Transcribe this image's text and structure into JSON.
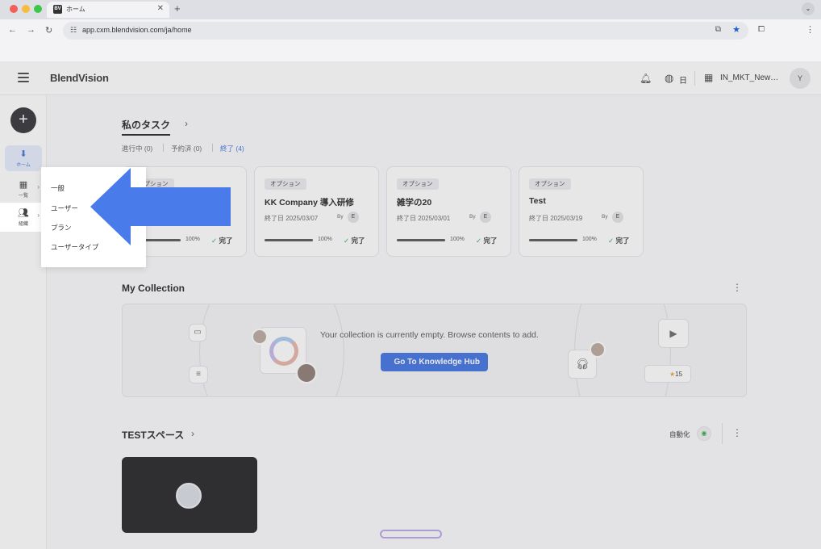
{
  "browser": {
    "tab_title": "ホーム",
    "favicon": "BV",
    "url": "app.cxm.blendvision.com/ja/home"
  },
  "header": {
    "logo": "BlendVision",
    "lang": "日",
    "org": "IN_MKT_New…",
    "avatar": "Y"
  },
  "sidebar": {
    "add": "+",
    "items": [
      {
        "label": "ホーム"
      },
      {
        "label": "一覧"
      },
      {
        "label": "組織"
      }
    ]
  },
  "submenu": {
    "items": [
      "一般",
      "ユーザー",
      "プラン",
      "ユーザータイプ"
    ]
  },
  "tasks": {
    "title": "私のタスク",
    "tabs": [
      "進行中 (0)",
      "予約済 (0)",
      "終了 (4)"
    ],
    "cards": [
      {
        "badge": "オプション",
        "title": "",
        "meta": "",
        "by": "",
        "pct": "100%",
        "done": "完了",
        "progress": 1.0
      },
      {
        "badge": "オプション",
        "title": "KK Company 導入研修",
        "meta": "終了日 2025/03/07",
        "by": "By",
        "e": "E",
        "pct": "100%",
        "done": "完了",
        "progress": 1.0
      },
      {
        "badge": "オプション",
        "title": "雑学の20",
        "meta": "終了日 2025/03/01",
        "by": "By",
        "e": "E",
        "pct": "100%",
        "done": "完了",
        "progress": 1.0
      },
      {
        "badge": "オプション",
        "title": "Test",
        "meta": "終了日 2025/03/19",
        "by": "By",
        "e": "E",
        "pct": "100%",
        "done": "完了",
        "progress": 1.0
      }
    ]
  },
  "collection": {
    "title": "My Collection",
    "empty_message": "Your collection is currently empty. Browse contents to add.",
    "button": "Go To Knowledge Hub",
    "count": "15"
  },
  "space": {
    "title": "TESTスペース",
    "auto_label": "自動化"
  },
  "colors": {
    "accent": "#3b6fe0",
    "arrow": "#4a7bea",
    "success": "#2fa84f"
  }
}
